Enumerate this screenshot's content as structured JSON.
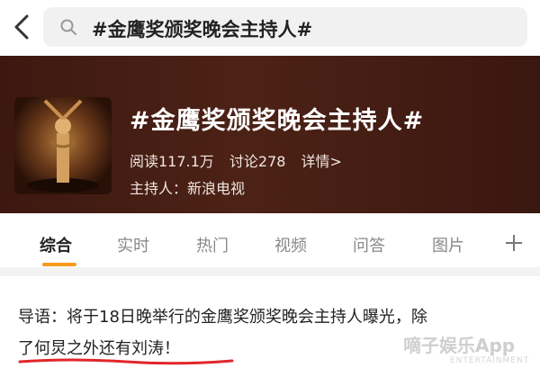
{
  "search": {
    "query": "#金鹰奖颁奖晚会主持人#"
  },
  "topic": {
    "title": "#金鹰奖颁奖晚会主持人#",
    "read_label": "阅读117.1万",
    "discuss_label": "讨论278",
    "details_label": "详情>",
    "host_label": "主持人：新浪电视"
  },
  "tabs": [
    "综合",
    "实时",
    "热门",
    "视频",
    "问答",
    "图片"
  ],
  "lead": {
    "line1": "导语：将于18日晚举行的金鹰奖颁奖晚会主持人曝光，除",
    "line2": "了何炅之外还有刘涛！"
  },
  "watermark": {
    "main": "嘀子娱乐App",
    "sub": "ENTERTAINMENT"
  },
  "colors": {
    "accent": "#f79a1e",
    "hero_bg": "#4d2216",
    "underline": "#e0262b"
  }
}
